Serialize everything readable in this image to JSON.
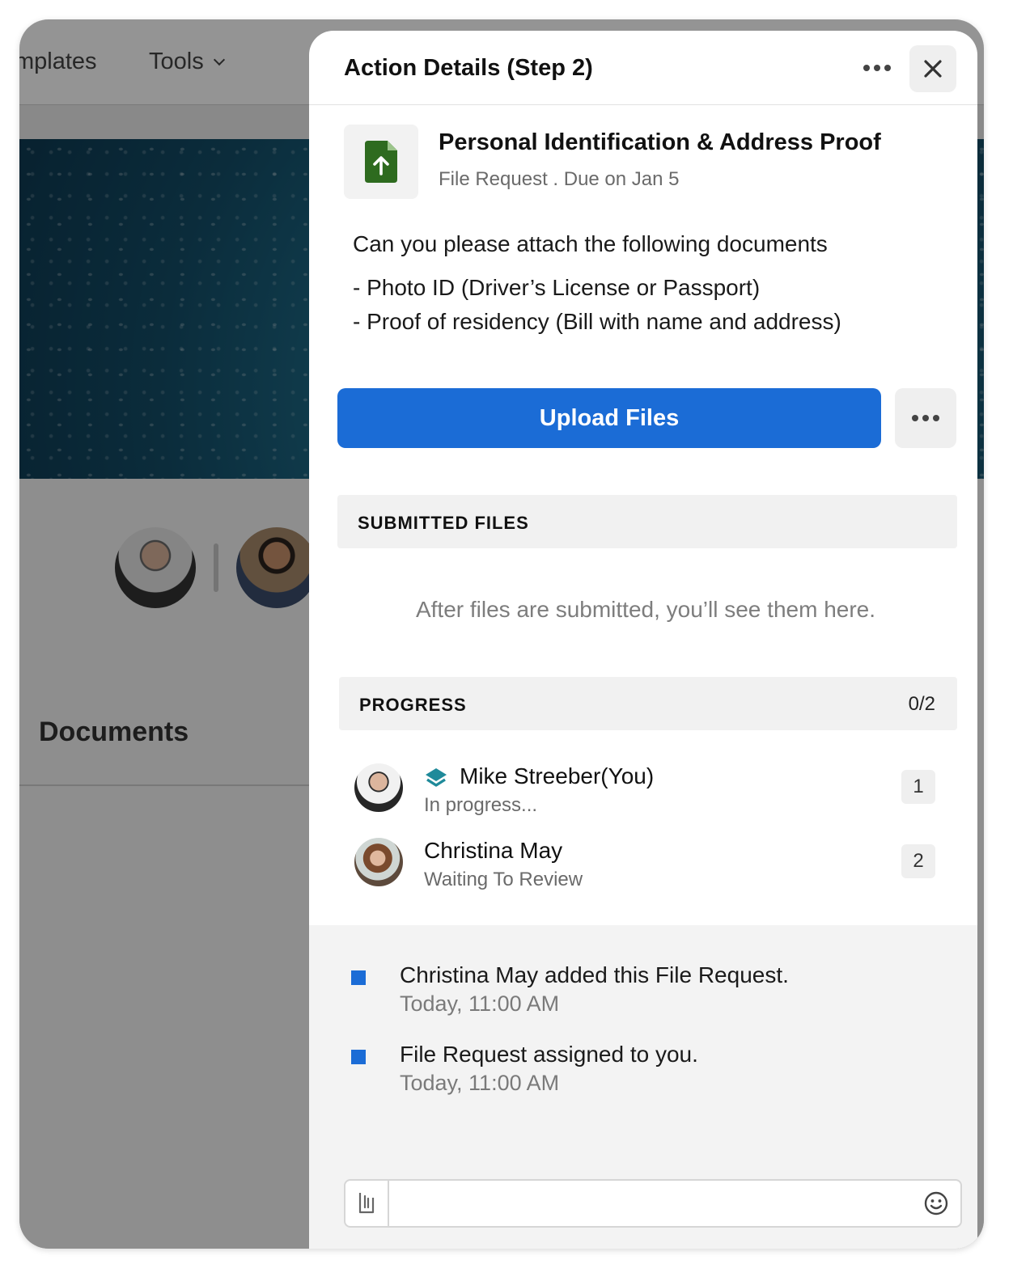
{
  "background": {
    "nav": {
      "templates_label": "mplates",
      "tools_label": "Tools"
    },
    "documents_heading": "Documents"
  },
  "panel": {
    "title": "Action Details (Step 2)",
    "file_request": {
      "title": "Personal Identification & Address Proof",
      "meta": "File Request . Due on Jan 5",
      "icon": "file-upload-icon",
      "icon_color": "#2e6b1f"
    },
    "description": {
      "line1": "Can you please attach the following documents",
      "line2": "- Photo ID (Driver’s License or Passport)",
      "line3": "- Proof of residency (Bill with name and address)"
    },
    "upload_button_label": "Upload Files",
    "submitted_files": {
      "label": "SUBMITTED FILES",
      "empty_text": "After files are submitted, you’ll see them here."
    },
    "progress": {
      "label": "PROGRESS",
      "count": "0/2",
      "people": [
        {
          "name": "Mike Streeber(You)",
          "status": "In progress...",
          "step": "1"
        },
        {
          "name": "Christina May",
          "status": "Waiting To Review",
          "step": "2"
        }
      ]
    },
    "activity": [
      {
        "text": "Christina May added this File Request.",
        "time": "Today, 11:00 AM"
      },
      {
        "text": "File Request assigned to you.",
        "time": "Today, 11:00 AM"
      }
    ],
    "composer": {
      "placeholder": ""
    }
  },
  "colors": {
    "accent": "#1b6cd6",
    "panel_bg": "#ffffff",
    "section_bg": "#f1f1f1",
    "stack_icon": "#1f8a9a"
  }
}
